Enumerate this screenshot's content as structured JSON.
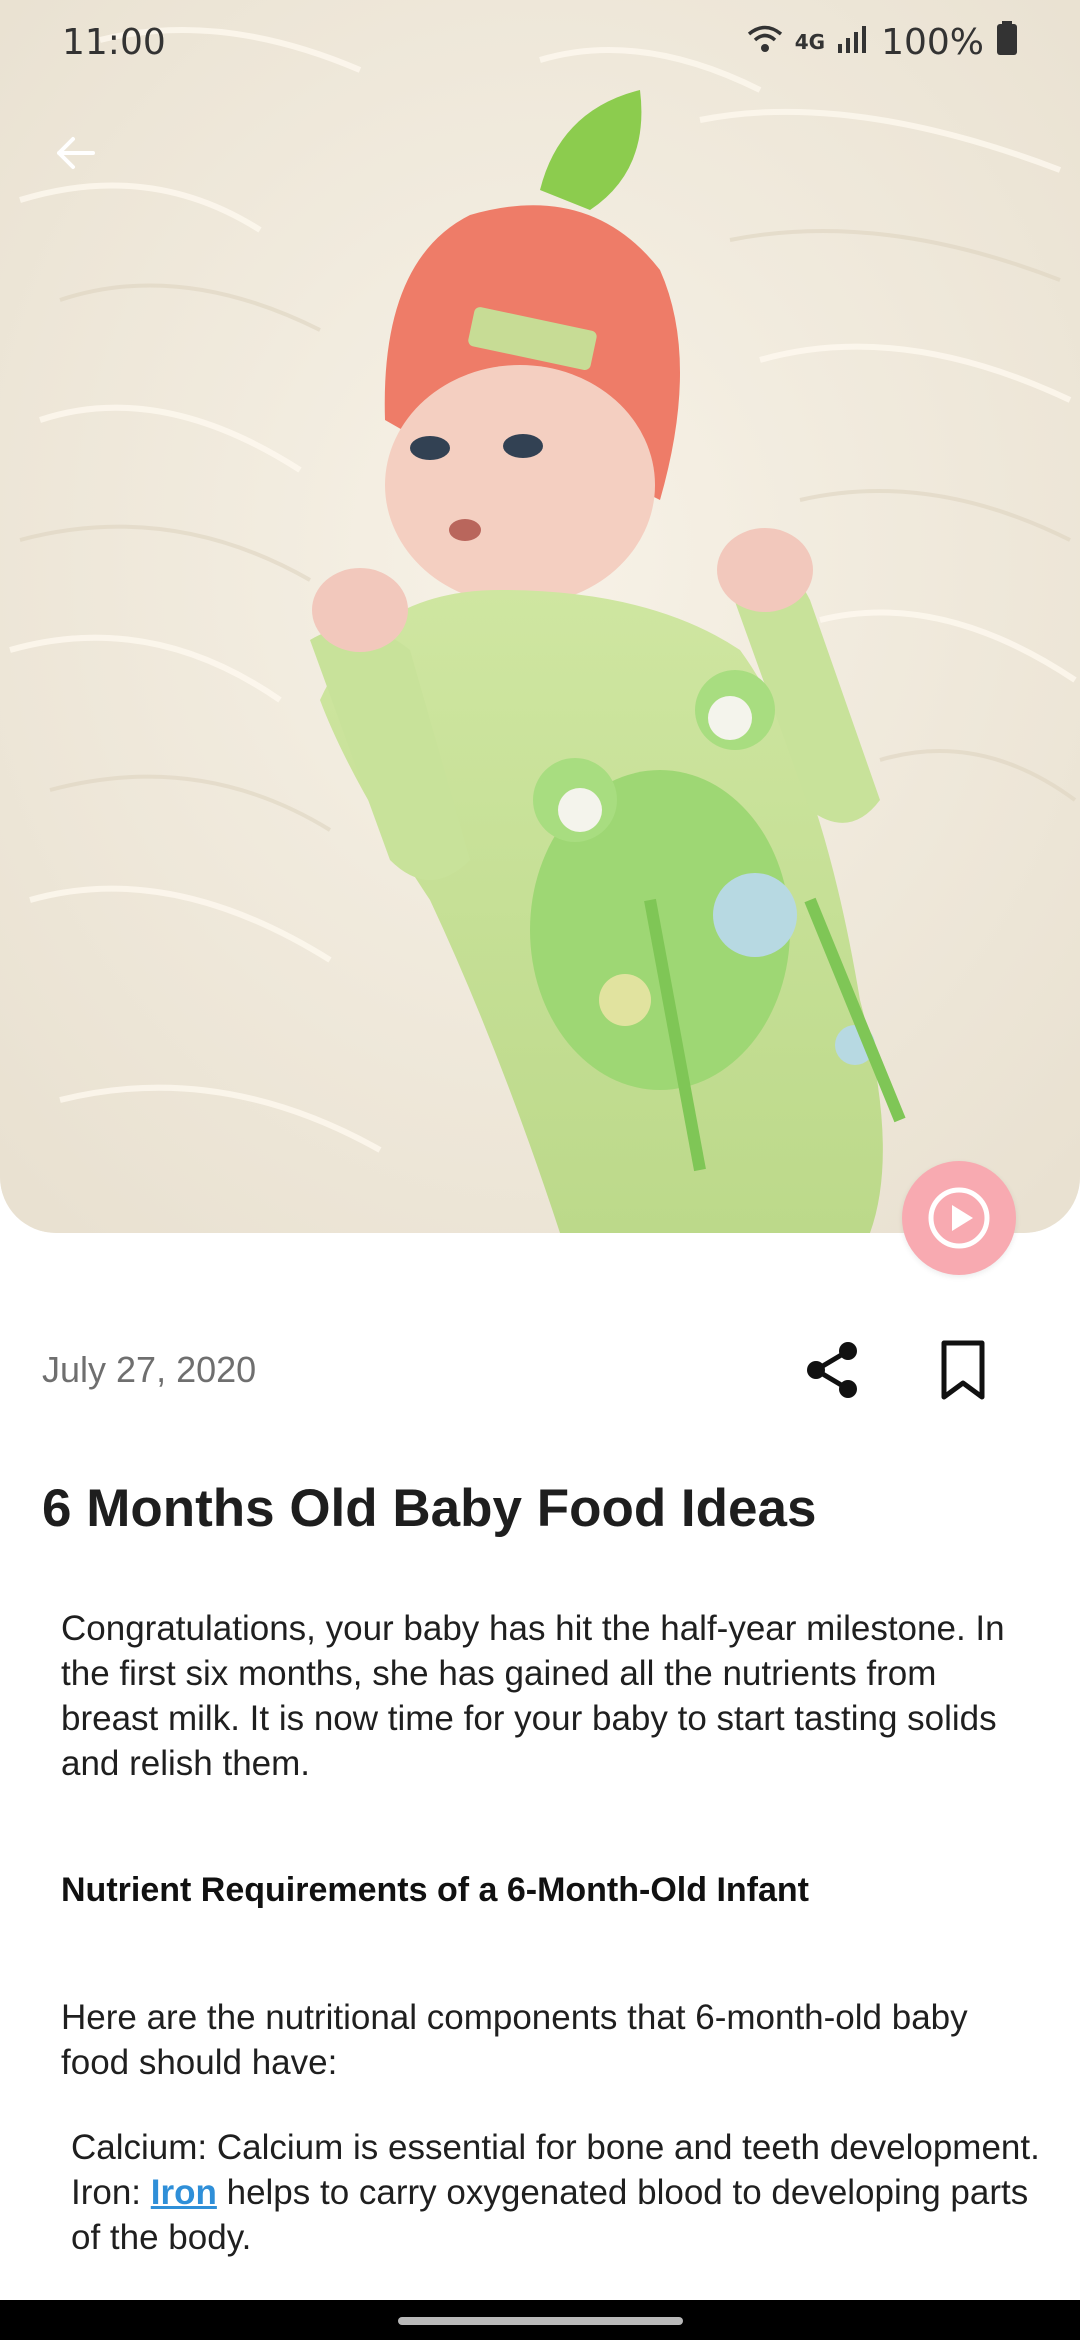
{
  "status_bar": {
    "time": "11:00",
    "network": "4G",
    "battery": "100%",
    "icons": [
      "wifi-icon",
      "network-4g-icon",
      "signal-icon",
      "battery-icon"
    ]
  },
  "hero": {
    "image": "baby-photo"
  },
  "article": {
    "date": "July 27, 2020",
    "title": "6 Months Old Baby Food Ideas",
    "intro": "Congratulations, your baby has hit the half-year milestone. In the first six months, she has gained all the nutrients from breast milk. It is now time for your baby to start tasting solids and relish them.",
    "subheading": "Nutrient Requirements of a 6-Month-Old Infant",
    "lead": "Here are the nutritional components that 6-month-old baby food should have:",
    "calcium_item": "Calcium: Calcium is essential for bone and teeth development.",
    "iron_prefix": "Iron: ",
    "iron_link": "Iron",
    "iron_suffix": " helps to carry oxygenated blood to developing parts of the body."
  },
  "colors": {
    "accent_pink": "#f8aab1",
    "link_blue": "#2f8fd8"
  }
}
